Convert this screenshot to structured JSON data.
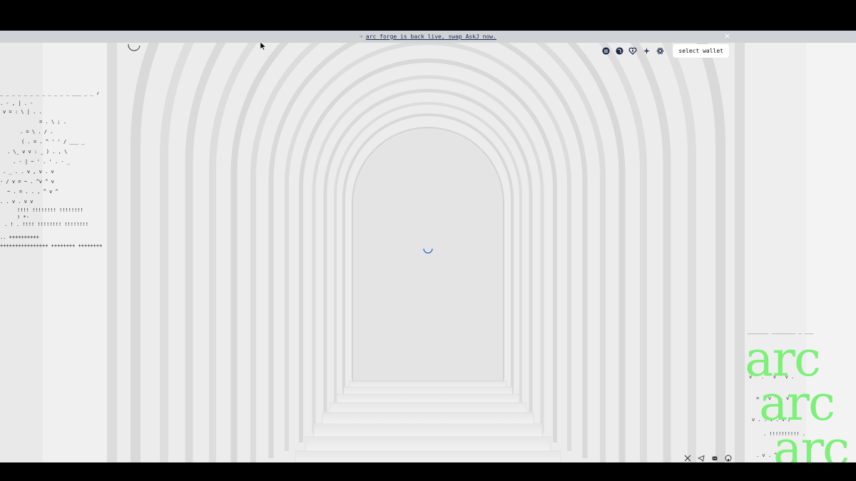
{
  "banner": {
    "icon": "hand-point-icon",
    "text": "arc forge is back live, swap AskJ now.",
    "close_label": "×"
  },
  "header": {
    "chain_icons": [
      "chain-solana-icon",
      "chain-globe-icon",
      "chain-heart-icon",
      "chain-star-icon",
      "chain-atom-icon"
    ],
    "wallet_button": "select wallet"
  },
  "footer": {
    "socials": [
      "x-icon",
      "telegram-icon",
      "discord-icon",
      "github-icon"
    ]
  },
  "decor": {
    "arc_words": [
      "arc",
      "arc",
      "arc"
    ]
  },
  "colors": {
    "accent_green": "#7df07a",
    "spinner": "#2f6fd6",
    "banner_bg": "#cfd2d6",
    "link": "#1d2a4a"
  }
}
